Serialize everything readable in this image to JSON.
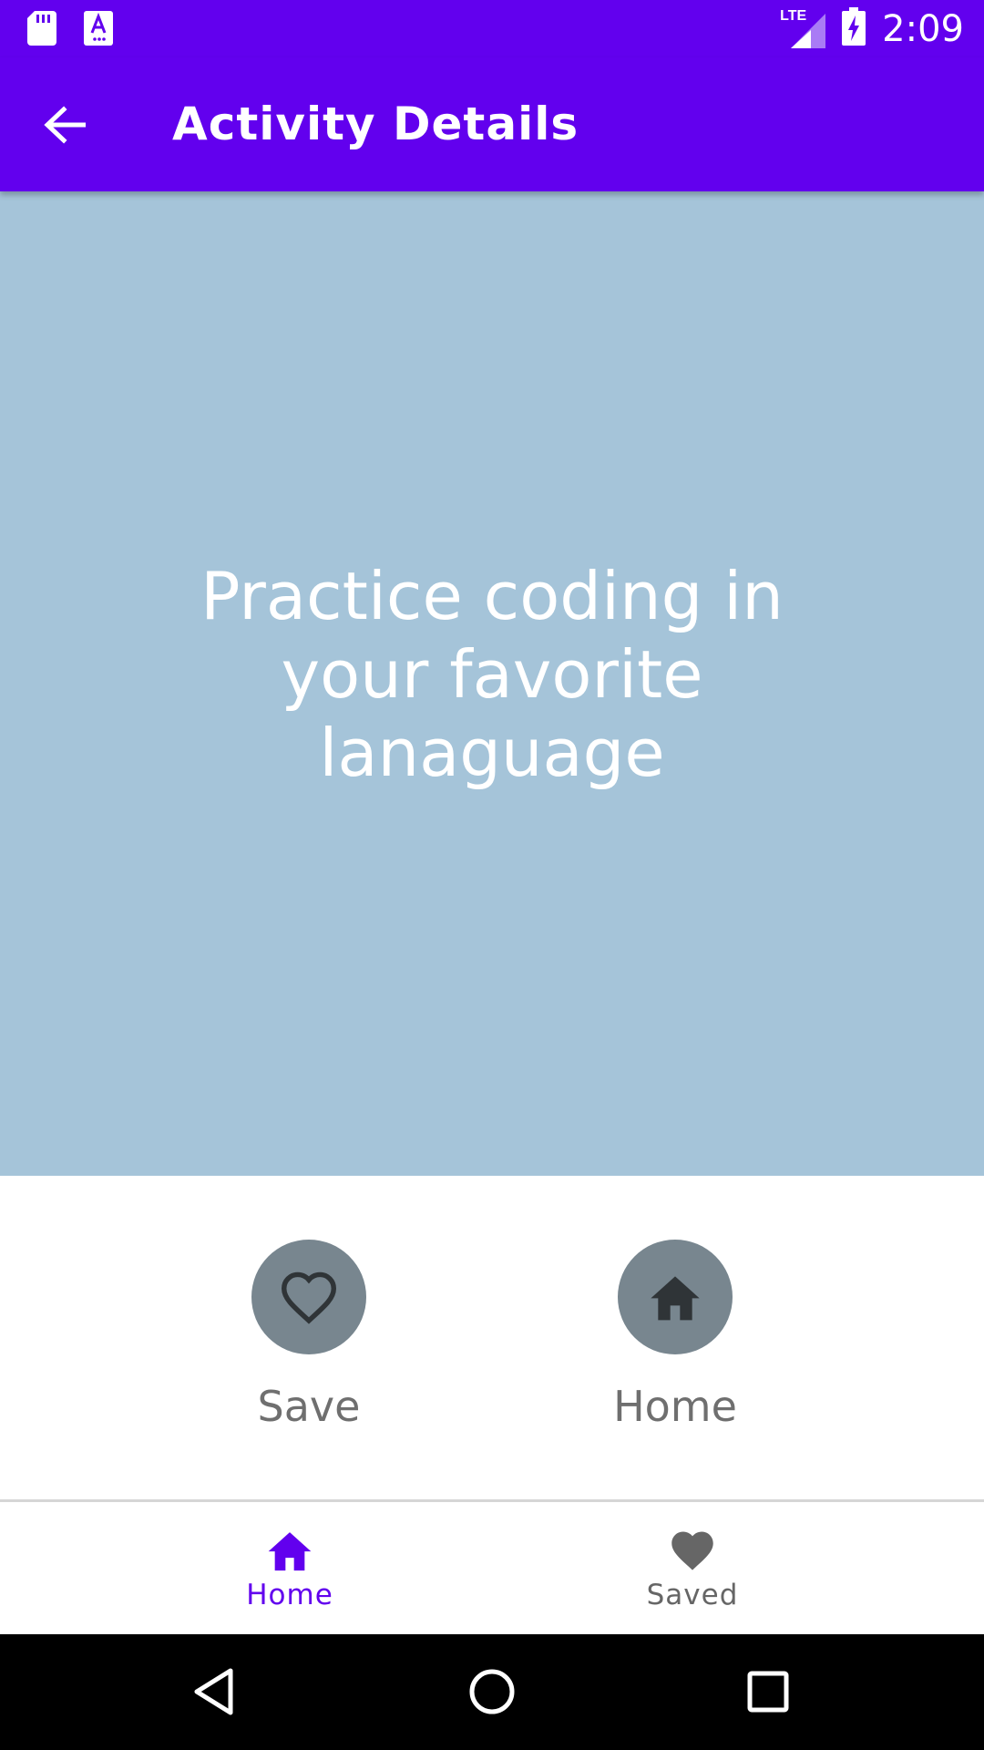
{
  "status_bar": {
    "time": "2:09",
    "network_type": "LTE",
    "icons": [
      "sd-card-icon",
      "text-a-icon",
      "signal-icon",
      "battery-charging-icon"
    ]
  },
  "app_bar": {
    "title": "Activity Details",
    "back_icon": "arrow-back-icon"
  },
  "hero": {
    "text": "Practice coding in your favorite lanaguage",
    "background_color": "#a5c4d9"
  },
  "actions": [
    {
      "label": "Save",
      "icon": "heart-outline-icon"
    },
    {
      "label": "Home",
      "icon": "home-icon"
    }
  ],
  "bottom_nav": {
    "items": [
      {
        "label": "Home",
        "icon": "home-icon",
        "selected": true
      },
      {
        "label": "Saved",
        "icon": "heart-icon",
        "selected": false
      }
    ]
  },
  "system_nav": {
    "buttons": [
      "back-triangle-icon",
      "home-circle-icon",
      "recents-square-icon"
    ]
  },
  "colors": {
    "primary": "#6200ee",
    "action_circle": "#78868f",
    "muted_text": "#6f6f6f"
  }
}
